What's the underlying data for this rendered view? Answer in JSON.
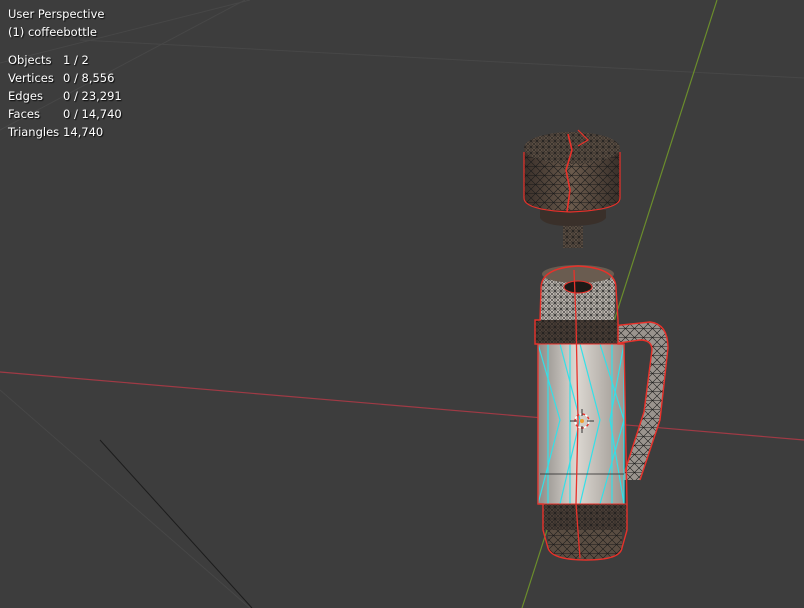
{
  "viewport": {
    "view_name": "User Perspective",
    "object_name": "(1) coffeebottle",
    "stats": [
      {
        "label": "Objects",
        "value": "1 / 2"
      },
      {
        "label": "Vertices",
        "value": "0 / 8,556"
      },
      {
        "label": "Edges",
        "value": "0 / 23,291"
      },
      {
        "label": "Faces",
        "value": "0 / 14,740"
      },
      {
        "label": "Triangles",
        "value": "14,740"
      }
    ],
    "colors": {
      "background": "#3d3d3d",
      "grid": "#474747",
      "x_axis": "#a03a45",
      "y_axis": "#6b8d2c",
      "selection_outline": "#e8312a",
      "active_edges": "#33e0e8",
      "mesh_body": "#b8b4ae",
      "mesh_dark": "#4a3e36"
    },
    "icons": [
      "origin-cursor-icon"
    ]
  }
}
